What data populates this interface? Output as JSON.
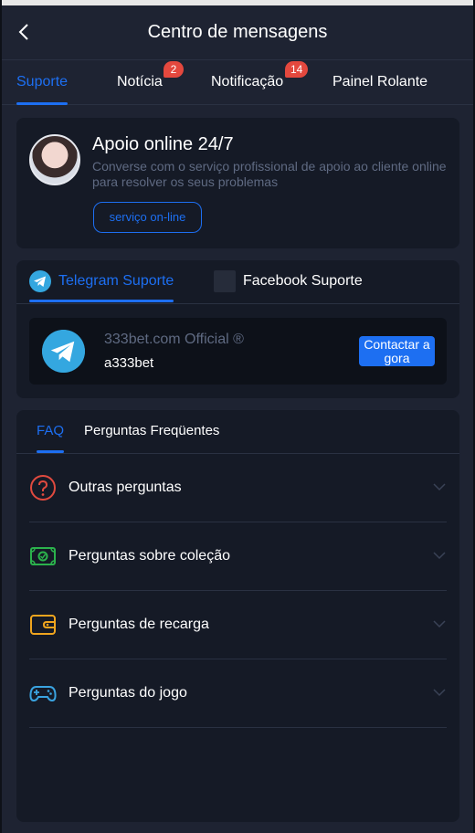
{
  "header": {
    "title": "Centro de mensagens"
  },
  "tabs": [
    {
      "label": "Suporte",
      "active": true,
      "badge": ""
    },
    {
      "label": "Notícia",
      "active": false,
      "badge": "2"
    },
    {
      "label": "Notificação",
      "active": false,
      "badge": "14"
    },
    {
      "label": "Painel Rolante",
      "active": false,
      "badge": ""
    }
  ],
  "support": {
    "title": "Apoio online 24/7",
    "description": "Converse com o serviço profissional de apoio ao cliente online para resolver os seus problemas",
    "button_label": "serviço on-line"
  },
  "channels": {
    "tabs": [
      {
        "label": "Telegram Suporte",
        "icon": "telegram-icon",
        "active": true
      },
      {
        "label": "Facebook Suporte",
        "icon": "facebook-icon",
        "active": false
      }
    ],
    "contact": {
      "name": "333bet.com Official ®",
      "id": "a333bet",
      "button_label": "Contactar a gora"
    }
  },
  "faq": {
    "tabs": [
      {
        "label": "FAQ",
        "active": true
      },
      {
        "label": "Perguntas Freqüentes",
        "active": false
      }
    ],
    "items": [
      {
        "label": "Outras perguntas",
        "icon": "question-icon"
      },
      {
        "label": "Perguntas sobre coleção",
        "icon": "money-icon"
      },
      {
        "label": "Perguntas de recarga",
        "icon": "wallet-icon"
      },
      {
        "label": "Perguntas do jogo",
        "icon": "gamepad-icon"
      }
    ]
  },
  "colors": {
    "accent": "#1d6ff2",
    "background": "#1e2332",
    "card": "#151a26",
    "badge": "#e4483e",
    "muted_text": "#5f6a82"
  }
}
